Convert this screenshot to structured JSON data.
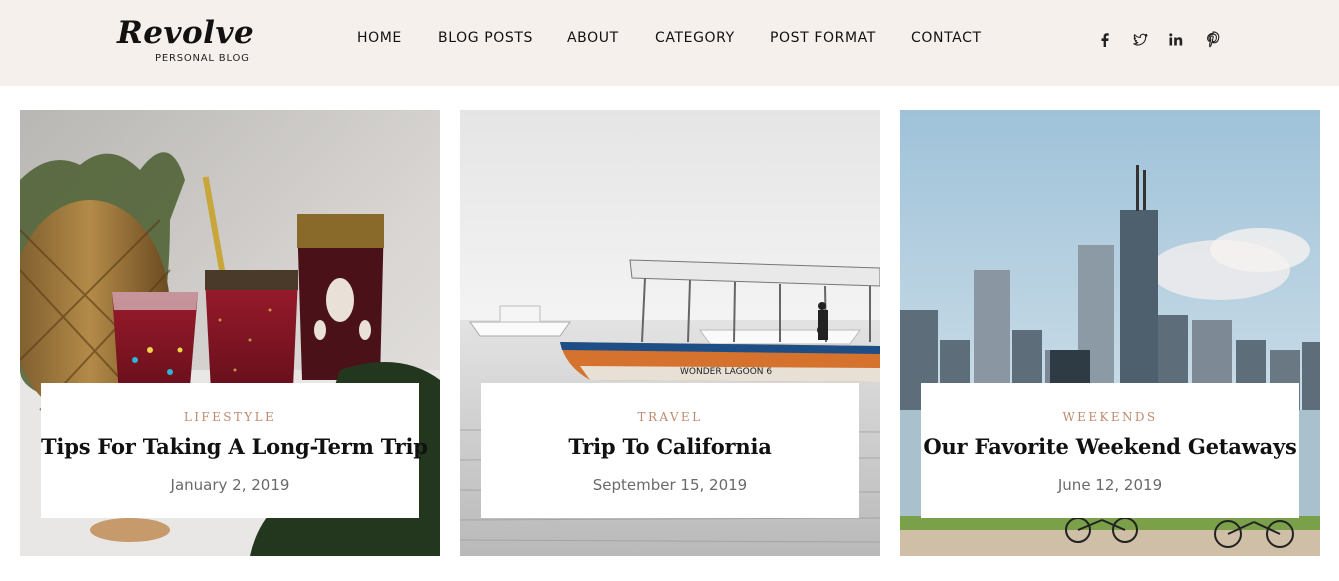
{
  "brand": {
    "name": "Revolve",
    "tagline": "PERSONAL BLOG"
  },
  "nav": {
    "items": [
      {
        "label": "HOME"
      },
      {
        "label": "BLOG POSTS"
      },
      {
        "label": "ABOUT"
      },
      {
        "label": "CATEGORY"
      },
      {
        "label": "POST FORMAT"
      },
      {
        "label": "CONTACT"
      }
    ]
  },
  "social": [
    {
      "icon": "facebook-icon"
    },
    {
      "icon": "twitter-icon"
    },
    {
      "icon": "linkedin-icon"
    },
    {
      "icon": "pinterest-icon"
    }
  ],
  "posts": [
    {
      "category": "LIFESTYLE",
      "title": "Tips For Taking A Long-Term Trip",
      "date": "January 2, 2019",
      "image": "drinks-and-pineapple-photo"
    },
    {
      "category": "TRAVEL",
      "title": "Trip To California",
      "date": "September 15, 2019",
      "image": "boat-on-water-photo"
    },
    {
      "category": "WEEKENDS",
      "title": "Our Favorite Weekend Getaways",
      "date": "June 12, 2019",
      "image": "city-skyline-photo"
    }
  ],
  "colors": {
    "header_bg": "#f6f0ec",
    "category_accent": "#c08a6d",
    "title": "#111111",
    "date": "#6a6a6a"
  }
}
